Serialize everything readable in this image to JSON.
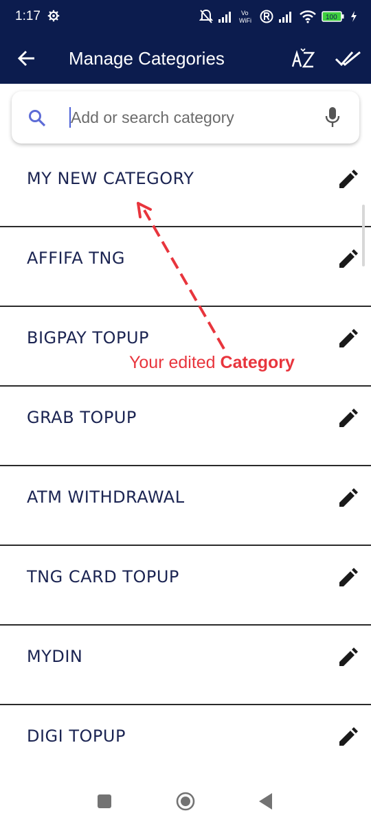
{
  "status_bar": {
    "time": "1:17",
    "network_label_top": "Vo",
    "network_label_bottom": "WiFi",
    "battery": "100"
  },
  "app_bar": {
    "title": "Manage Categories",
    "sort_icon": "sort-az-icon",
    "confirm_icon": "double-check-icon"
  },
  "search": {
    "placeholder": "Add or search category",
    "value": ""
  },
  "categories": [
    {
      "label": "MY NEW CATEGORY"
    },
    {
      "label": "AFFIFA TNG"
    },
    {
      "label": "BIGPAY TOPUP"
    },
    {
      "label": "GRAB TOPUP"
    },
    {
      "label": "ATM WITHDRAWAL"
    },
    {
      "label": "TNG CARD TOPUP"
    },
    {
      "label": "MYDIN"
    },
    {
      "label": "DIGI TOPUP"
    }
  ],
  "annotation": {
    "text_regular": "Your edited ",
    "text_bold": "Category",
    "color": "#e8353d"
  },
  "colors": {
    "header_bg": "#0c1c4e",
    "item_text": "#1b2452"
  }
}
